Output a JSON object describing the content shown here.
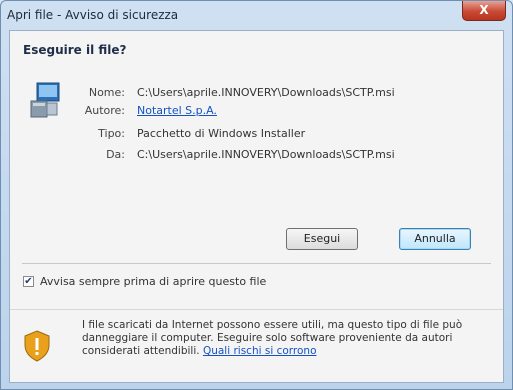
{
  "window": {
    "title": "Apri file - Avviso di sicurezza",
    "close_label": "X"
  },
  "dialog": {
    "heading": "Eseguire il file?",
    "fields": [
      {
        "label": "Nome:",
        "value": "C:\\Users\\aprile.INNOVERY\\Downloads\\SCTP.msi"
      },
      {
        "label": "Autore:",
        "value": "Notartel S.p.A."
      },
      {
        "label": "Tipo:",
        "value": "Pacchetto di Windows Installer"
      },
      {
        "label": "Da:",
        "value": "C:\\Users\\aprile.INNOVERY\\Downloads\\SCTP.msi"
      }
    ],
    "buttons": {
      "run": "Esegui",
      "cancel": "Annulla"
    },
    "checkbox": {
      "checked": true,
      "label": "Avvisa sempre prima di aprire questo file"
    },
    "warning": {
      "text": "I file scaricati da Internet possono essere utili, ma questo tipo di file può danneggiare il computer. Eseguire solo software proveniente da autori considerati attendibili.",
      "link": "Quali rischi si corrono"
    }
  }
}
